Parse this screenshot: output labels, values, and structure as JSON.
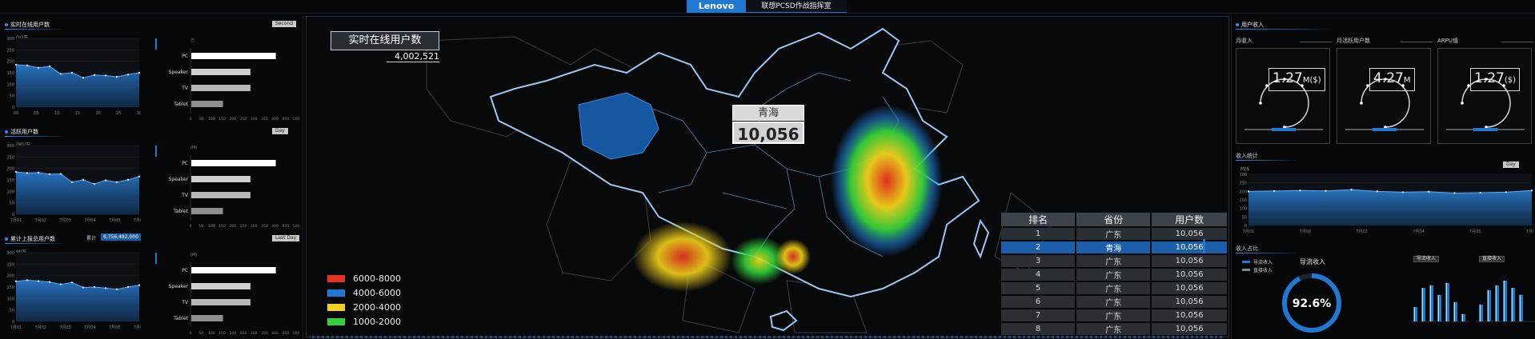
{
  "header": {
    "brand": "Lenovo",
    "title": "联想PCSD作战指挥室"
  },
  "left": {
    "panels": [
      {
        "title": "实时在线用户数",
        "unit": "(U)万",
        "tag": "Second",
        "y_ticks": [
          "300",
          "250",
          "200",
          "150",
          "100",
          "50",
          "0"
        ],
        "x_ticks": [
          "00",
          "05",
          "10",
          "15",
          "20",
          "25",
          "30"
        ],
        "series": [
          185,
          182,
          172,
          178,
          145,
          150,
          128,
          140,
          138,
          132,
          142,
          150
        ]
      },
      {
        "title": "活跃用户数",
        "unit": "(M)/万",
        "tag": "Day",
        "y_ticks": [
          "300",
          "250",
          "200",
          "150",
          "100",
          "50",
          "0"
        ],
        "x_ticks": [
          "7月01",
          "7月02",
          "7月03",
          "7月04",
          "7月05",
          "7月06"
        ],
        "series": [
          185,
          180,
          182,
          175,
          176,
          140,
          150,
          132,
          148,
          140,
          150,
          165
        ]
      },
      {
        "title": "累计上报总用户数",
        "unit": "M/万",
        "tag": "Last Day",
        "extra_label": "累计",
        "extra_value": "6,756,492,000",
        "y_ticks": [
          "300",
          "250",
          "200",
          "150",
          "100",
          "50",
          "0"
        ],
        "x_ticks": [
          "7月01",
          "7月02",
          "7月03",
          "7月04",
          "7月05",
          "7月06"
        ],
        "series": [
          175,
          180,
          176,
          172,
          162,
          170,
          148,
          150,
          145,
          140,
          150,
          158
        ]
      }
    ],
    "bars": {
      "categories": [
        "PC",
        "Speaker",
        "TV",
        "Tablet"
      ],
      "values": [
        400,
        280,
        280,
        150
      ],
      "axis": [
        "0",
        "50",
        "100",
        "150",
        "200",
        "250",
        "300",
        "350",
        "400",
        "450",
        "500"
      ],
      "units": [
        "万",
        "(M)",
        "(M)"
      ]
    }
  },
  "map": {
    "title": "实时在线用户数",
    "total": "4,002,521",
    "highlight_name": "青海",
    "highlight_value": "10,056",
    "legend": [
      {
        "label": "6000-8000",
        "color": "#e8321f"
      },
      {
        "label": "4000-6000",
        "color": "#1f78d1"
      },
      {
        "label": "2000-4000",
        "color": "#f2d21b"
      },
      {
        "label": "1000-2000",
        "color": "#33d13a"
      }
    ],
    "rank_table": {
      "headers": [
        "排名",
        "省份",
        "用户数"
      ],
      "rows": [
        [
          "1",
          "广东",
          "10,056"
        ],
        [
          "2",
          "青海",
          "10,056"
        ],
        [
          "3",
          "广东",
          "10,056"
        ],
        [
          "4",
          "广东",
          "10,056"
        ],
        [
          "5",
          "广东",
          "10,056"
        ],
        [
          "6",
          "广东",
          "10,056"
        ],
        [
          "7",
          "广东",
          "10,056"
        ],
        [
          "8",
          "广东",
          "10,056"
        ]
      ],
      "selected_index": 1
    }
  },
  "right": {
    "title": "用户收入",
    "gauges": [
      {
        "title": "月收入",
        "value": "1.27",
        "unit": "M($)"
      },
      {
        "title": "月活跃用户数",
        "value": "4.27",
        "unit": "M"
      },
      {
        "title": "ARPU值",
        "value": "1.27",
        "unit": "($)"
      }
    ],
    "revenue_stats": {
      "title": "收入统计",
      "tag": "Day",
      "unit": "M/$",
      "y_ticks": [
        "300",
        "250",
        "200",
        "150",
        "100",
        "50",
        "0"
      ],
      "x_ticks": [
        "7月01",
        "7月02",
        "7月03",
        "7月04",
        "7月05",
        "7月06"
      ],
      "series": [
        200,
        202,
        205,
        203,
        210,
        200,
        195,
        198,
        190,
        192,
        195,
        205
      ]
    },
    "revenue_share": {
      "title": "收入占比",
      "legend": [
        "导流收入",
        "直接收入"
      ],
      "donut_label": "导流收入",
      "donut_percent": "92.6%",
      "donut_fraction": 0.926,
      "bar_group_titles": [
        "导流收入",
        "直接收入"
      ],
      "bars_a": [
        30,
        70,
        75,
        55,
        80,
        40,
        15
      ],
      "bars_b": [
        35,
        65,
        75,
        85,
        70,
        55
      ]
    }
  }
}
